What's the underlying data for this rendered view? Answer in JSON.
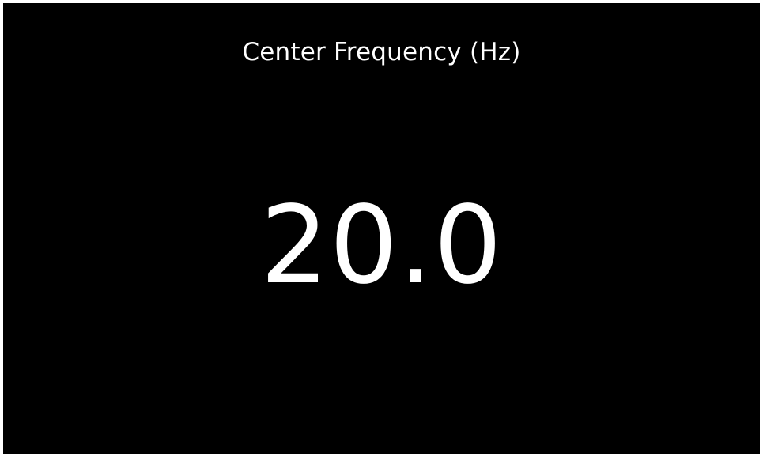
{
  "display": {
    "label": "Center Frequency (Hz)",
    "value": "20.0"
  },
  "colors": {
    "background": "#000000",
    "text": "#ffffff",
    "border": "#ffffff"
  }
}
